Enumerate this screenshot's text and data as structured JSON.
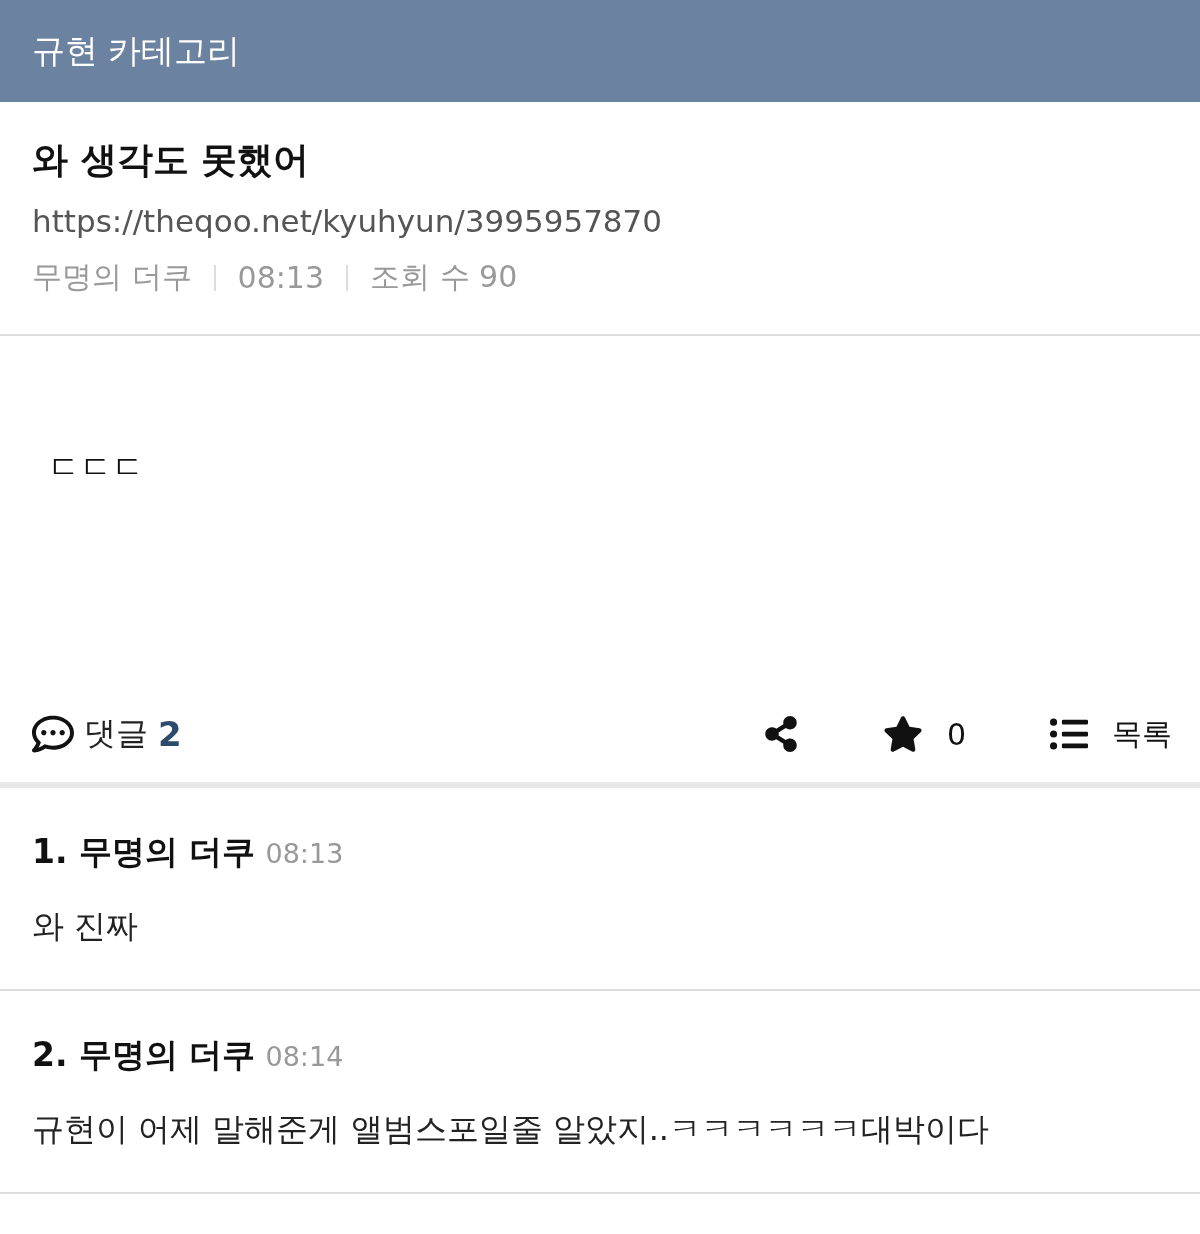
{
  "header": {
    "title": "규현 카테고리"
  },
  "post": {
    "title": "와 생각도 못했어",
    "url": "https://theqoo.net/kyuhyun/3995957870",
    "meta": [
      "무명의 더쿠",
      "08:13",
      "조회 수 90"
    ],
    "body": "ㄷㄷㄷ"
  },
  "actions": {
    "comments_label": "댓글",
    "comments_count": "2",
    "star_count": "0",
    "list_label": "목록"
  },
  "comments": [
    {
      "number": "1.",
      "author": "무명의 더쿠",
      "time": "08:13",
      "text": "와 진짜"
    },
    {
      "number": "2.",
      "author": "무명의 더쿠",
      "time": "08:14",
      "text": "규현이 어제 말해준게 앨범스포일줄 알았지..ㅋㅋㅋㅋㅋㅋ대박이다"
    }
  ]
}
